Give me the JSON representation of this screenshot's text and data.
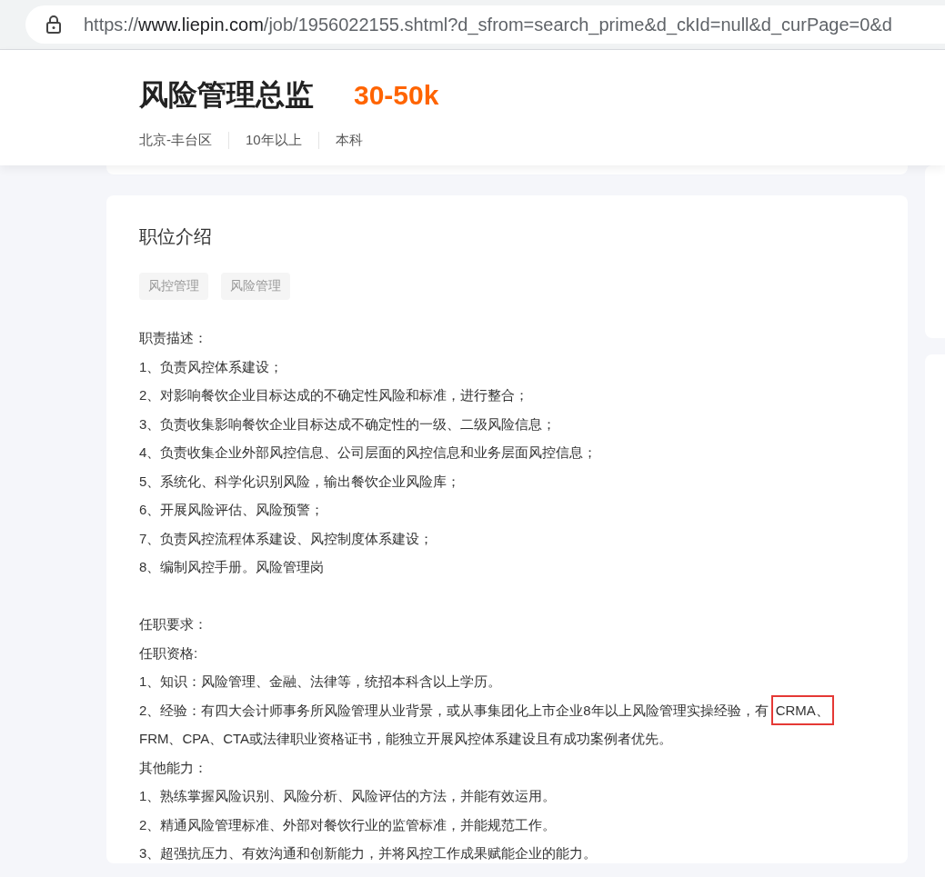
{
  "address_bar": {
    "scheme": "https://",
    "host": "www.liepin.com",
    "path": "/job/1956022155.shtml?d_sfrom=search_prime&d_ckId=null&d_curPage=0&d"
  },
  "job": {
    "title": "风险管理总监",
    "salary": "30-50k",
    "meta": [
      "北京-丰台区",
      "10年以上",
      "本科"
    ]
  },
  "section": {
    "heading": "职位介绍",
    "tags": [
      "风控管理",
      "风险管理"
    ],
    "paragraphs": [
      {
        "kind": "text",
        "text": "职责描述："
      },
      {
        "kind": "text",
        "text": "1、负责风控体系建设；"
      },
      {
        "kind": "text",
        "text": "2、对影响餐饮企业目标达成的不确定性风险和标准，进行整合；"
      },
      {
        "kind": "text",
        "text": "3、负责收集影响餐饮企业目标达成不确定性的一级、二级风险信息；"
      },
      {
        "kind": "text",
        "text": "4、负责收集企业外部风控信息、公司层面的风控信息和业务层面风控信息；"
      },
      {
        "kind": "text",
        "text": "5、系统化、科学化识别风险，输出餐饮企业风险库；"
      },
      {
        "kind": "text",
        "text": "6、开展风险评估、风险预警；"
      },
      {
        "kind": "text",
        "text": "7、负责风控流程体系建设、风控制度体系建设；"
      },
      {
        "kind": "text",
        "text": "8、编制风控手册。风险管理岗"
      },
      {
        "kind": "blank"
      },
      {
        "kind": "text",
        "text": "任职要求："
      },
      {
        "kind": "text",
        "text": "任职资格:"
      },
      {
        "kind": "text",
        "text": "1、知识：风险管理、金融、法律等，统招本科含以上学历。"
      },
      {
        "kind": "marked",
        "before": "2、经验：有四大会计师事务所风险管理从业背景，或从事集团化上市企业8年以上风险管理实操经验，有",
        "marked": "CRMA、",
        "after": "FRM、CPA、CTA或法律职业资格证书，能独立开展风控体系建设且有成功案例者优先。"
      },
      {
        "kind": "text",
        "text": "其他能力："
      },
      {
        "kind": "text",
        "text": "1、熟练掌握风险识别、风险分析、风险评估的方法，并能有效运用。"
      },
      {
        "kind": "text",
        "text": "2、精通风险管理标准、外部对餐饮行业的监管标准，并能规范工作。"
      },
      {
        "kind": "text",
        "text": "3、超强抗压力、有效沟通和创新能力，并将风控工作成果赋能企业的能力。"
      }
    ]
  }
}
